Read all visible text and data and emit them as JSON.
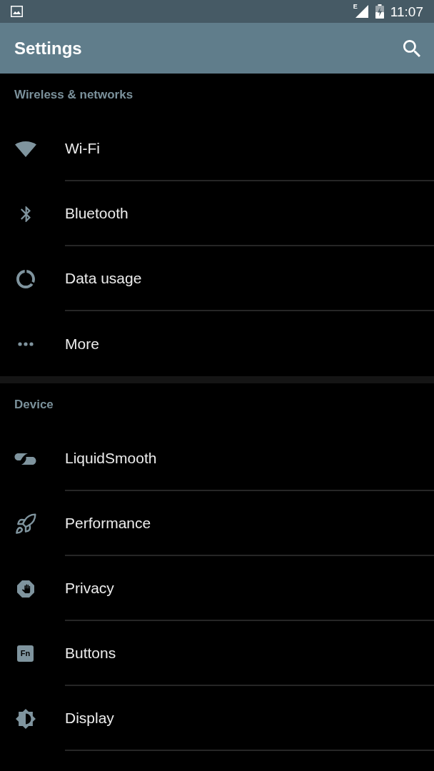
{
  "status_bar": {
    "network_type": "E",
    "time": "11:07"
  },
  "app_bar": {
    "title": "Settings"
  },
  "sections": [
    {
      "title": "Wireless & networks",
      "items": [
        {
          "label": "Wi-Fi"
        },
        {
          "label": "Bluetooth"
        },
        {
          "label": "Data usage"
        },
        {
          "label": "More"
        }
      ]
    },
    {
      "title": "Device",
      "items": [
        {
          "label": "LiquidSmooth"
        },
        {
          "label": "Performance"
        },
        {
          "label": "Privacy"
        },
        {
          "label": "Buttons",
          "icon_label": "Fn"
        },
        {
          "label": "Display"
        }
      ]
    }
  ]
}
